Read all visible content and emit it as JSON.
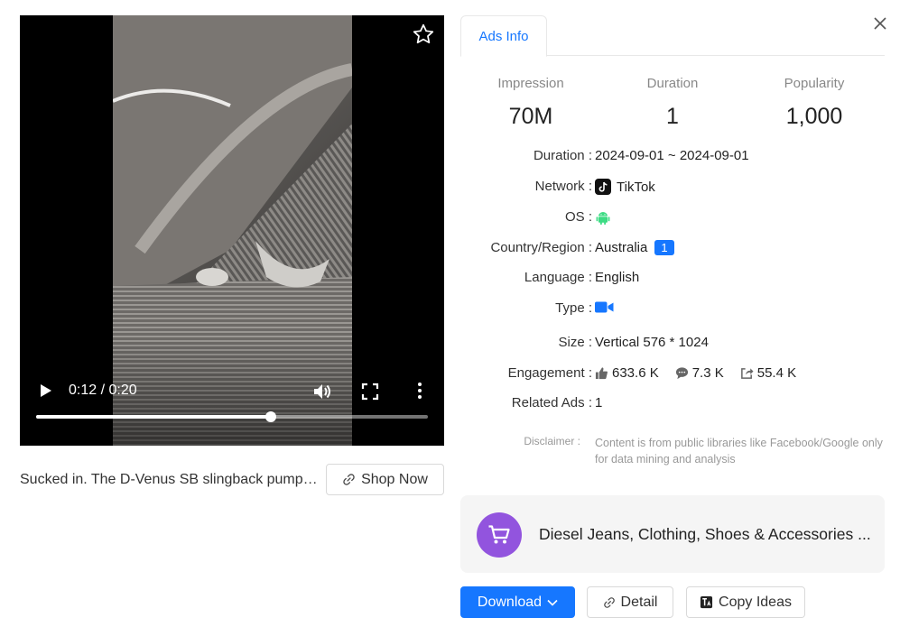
{
  "video": {
    "time": "0:12 / 0:20",
    "progress": 0.6,
    "caption": "Sucked in. The D-Venus SB slingback pump in...",
    "shop_label": "Shop Now"
  },
  "tabs": [
    {
      "label": "Ads Info",
      "active": true
    }
  ],
  "stats": [
    {
      "label": "Impression",
      "value": "70M"
    },
    {
      "label": "Duration",
      "value": "1"
    },
    {
      "label": "Popularity",
      "value": "1,000"
    }
  ],
  "details": {
    "duration": {
      "label": "Duration :",
      "value": "2024-09-01 ~ 2024-09-01"
    },
    "network": {
      "label": "Network :",
      "value": "TikTok",
      "icon": "tiktok-icon"
    },
    "os": {
      "label": "OS :",
      "icon": "android-icon",
      "color": "#3ddc84"
    },
    "country": {
      "label": "Country/Region :",
      "value": "Australia",
      "badge": "1"
    },
    "language": {
      "label": "Language :",
      "value": "English"
    },
    "type": {
      "label": "Type :",
      "icon": "video-camera-icon",
      "color": "#1677ff"
    },
    "size": {
      "label": "Size :",
      "value": "Vertical 576 * 1024"
    },
    "engagement": {
      "label": "Engagement :",
      "likes": "633.6 K",
      "comments": "7.3 K",
      "shares": "55.4 K"
    },
    "related": {
      "label": "Related Ads :",
      "value": "1"
    }
  },
  "disclaimer": {
    "label": "Disclaimer :",
    "text": "Content is from public libraries like Facebook/Google only for data mining and analysis"
  },
  "brand": {
    "name": "Diesel Jeans, Clothing, Shoes & Accessories ...",
    "avatar_color": "#9254de"
  },
  "actions": {
    "download": "Download",
    "detail": "Detail",
    "copy_ideas": "Copy Ideas"
  },
  "colors": {
    "accent": "#1677ff"
  }
}
